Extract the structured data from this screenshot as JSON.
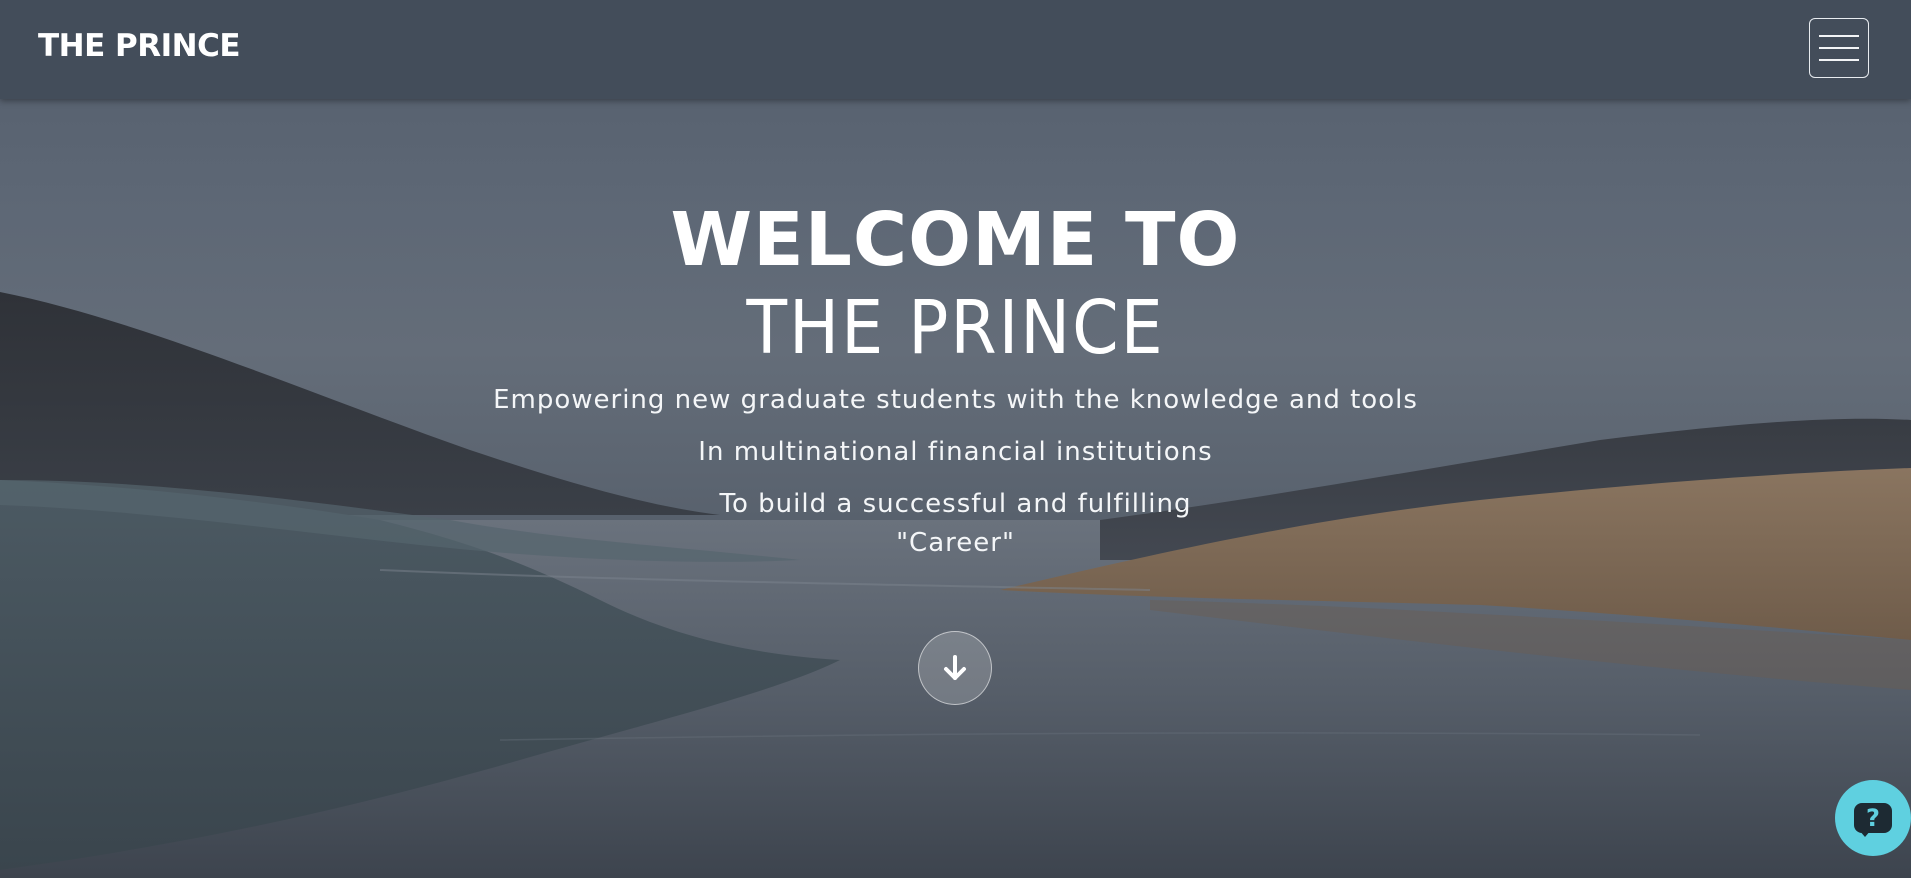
{
  "navbar": {
    "brand": "THE PRINCE",
    "menu_icon": "hamburger-menu-icon"
  },
  "hero": {
    "welcome": "WELCOME TO",
    "title": "THE PRINCE",
    "tagline_1": "Empowering new graduate students with the knowledge and tools",
    "tagline_2": "In multinational financial institutions",
    "tagline_3": "To build a successful and fulfilling",
    "tagline_4": "\"Career\""
  },
  "scroll_button": {
    "icon": "arrow-down-icon"
  },
  "help_button": {
    "icon": "question-icon",
    "glyph": "?"
  },
  "colors": {
    "navbar": "#434d5a",
    "help_accent": "#5fd0e0",
    "text": "#ffffff"
  }
}
